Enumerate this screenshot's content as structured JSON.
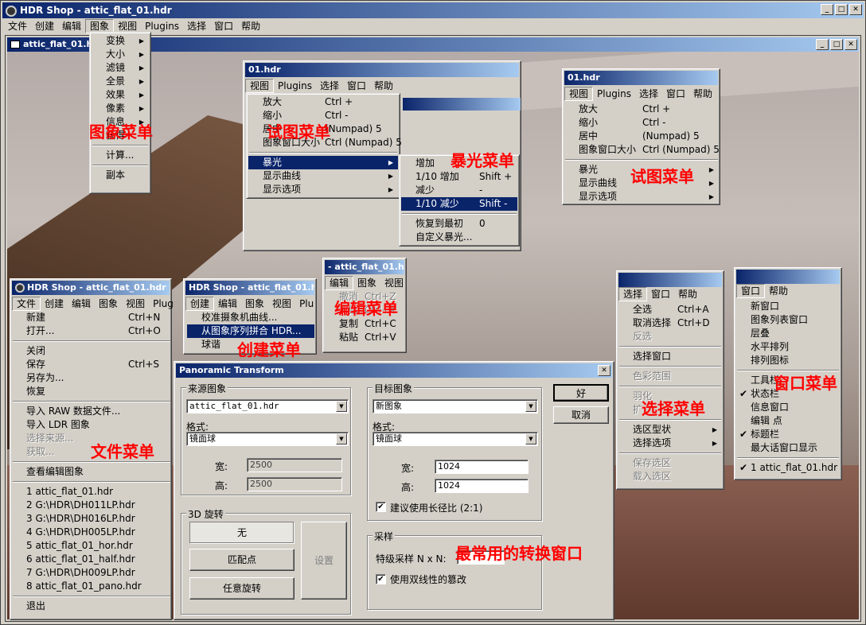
{
  "main": {
    "title": "HDR Shop - attic_flat_01.hdr",
    "menu": [
      "文件",
      "创建",
      "编辑",
      "图象",
      "视图",
      "Plugins",
      "选择",
      "窗口",
      "帮助"
    ]
  },
  "child": {
    "title": "attic_flat_01.hdr"
  },
  "image_menu": {
    "items": [
      "变换",
      "大小",
      "滤镜",
      "全景",
      "效果",
      "像素",
      "信息",
      "获得",
      "计算...",
      "副本"
    ],
    "label": "图象菜单"
  },
  "view1": {
    "title": "01.hdr",
    "menu": [
      "视图",
      "Plugins",
      "选择",
      "窗口",
      "帮助"
    ],
    "items": [
      "放大",
      "缩小",
      "居中",
      "图象窗口大小",
      "暴光",
      "显示曲线",
      "显示选项"
    ],
    "shortcuts": [
      "Ctrl +",
      "Ctrl -",
      "(Numpad) 5",
      "Ctrl (Numpad) 5"
    ],
    "label": "试图菜单"
  },
  "exposure": {
    "items": [
      "增加",
      "1/10 增加",
      "减少",
      "1/10 减少",
      "恢复到最初",
      "自定义暴光..."
    ],
    "shortcuts": [
      "Shift +",
      "-",
      "Shift -",
      "0"
    ],
    "label": "暴光菜单"
  },
  "view2": {
    "title": "01.hdr",
    "menu": [
      "视图",
      "Plugins",
      "选择",
      "窗口",
      "帮助"
    ],
    "items": [
      "放大",
      "缩小",
      "居中",
      "图象窗口大小",
      "暴光",
      "显示曲线",
      "显示选项"
    ],
    "shortcuts": [
      "Ctrl +",
      "Ctrl -",
      "(Numpad) 5",
      "Ctrl (Numpad) 5"
    ],
    "label": "试图菜单"
  },
  "file": {
    "title": "HDR Shop - attic_flat_01.hdr",
    "menu": [
      "文件",
      "创建",
      "编辑",
      "图象",
      "视图",
      "Plug"
    ],
    "items": [
      "新建",
      "打开...",
      "关闭",
      "保存",
      "另存为...",
      "恢复",
      "导入 RAW 数据文件...",
      "导入 LDR 图象",
      "选择来源...",
      "获取...",
      "查看编辑图象",
      "1 attic_flat_01.hdr",
      "2 G:\\HDR\\DH011LP.hdr",
      "3 G:\\HDR\\DH016LP.hdr",
      "4 G:\\HDR\\DH005LP.hdr",
      "5 attic_flat_01_hor.hdr",
      "6 attic_flat_01_half.hdr",
      "7 G:\\HDR\\DH009LP.hdr",
      "8 attic_flat_01_pano.hdr",
      "退出"
    ],
    "shortcuts": [
      "Ctrl+N",
      "Ctrl+O",
      "Ctrl+S"
    ],
    "label": "文件菜单"
  },
  "create": {
    "title": "HDR Shop - attic_flat_01.hdr",
    "menu": [
      "创建",
      "编辑",
      "图象",
      "视图",
      "Plu"
    ],
    "items": [
      "校准摄象机曲线...",
      "从图象序列拼合 HDR...",
      "球谐"
    ],
    "label": "创建菜单"
  },
  "edit": {
    "title": "- attic_flat_01.hdr",
    "menu": [
      "编辑",
      "图象",
      "视图"
    ],
    "items": [
      "撤消",
      "剪贴",
      "复制",
      "粘贴"
    ],
    "shortcuts": [
      "Ctrl+Z",
      "Ctrl+X",
      "Ctrl+C",
      "Ctrl+V"
    ],
    "label": "编辑菜单"
  },
  "select": {
    "menu": [
      "选择",
      "窗口",
      "帮助"
    ],
    "items": [
      "全选",
      "取消选择",
      "反选",
      "选择窗口",
      "色彩范围",
      "羽化",
      "扩",
      "选区型状",
      "选择选项",
      "保存选区",
      "载入选区"
    ],
    "shortcuts": [
      "Ctrl+A",
      "Ctrl+D"
    ],
    "label": "选择菜单"
  },
  "window": {
    "menu": [
      "窗口",
      "帮助"
    ],
    "items": [
      "新窗口",
      "图象列表窗口",
      "层叠",
      "水平排列",
      "排列图标",
      "工具栏",
      "状态栏",
      "信息窗口",
      "编辑 点",
      "标题栏",
      "最大话窗口显示",
      "1 attic_flat_01.hdr"
    ],
    "label": "窗口菜单"
  },
  "dialog": {
    "title": "Panoramic Transform",
    "close": "✕",
    "source_group": "来源图象",
    "source_value": "attic_flat_01.hdr",
    "format_label": "格式:",
    "source_format": "镜面球",
    "width_label": "宽:",
    "height_label": "高:",
    "source_width": "2500",
    "source_height": "2500",
    "target_group": "目标图象",
    "target_value": "新图象",
    "target_format": "镜面球",
    "target_width": "1024",
    "target_height": "1024",
    "aspect_label": "建议使用长径比 (2:1)",
    "rotation_group": "3D 旋转",
    "rot_none": "无",
    "rot_match": "匹配点",
    "rot_any": "任意旋转",
    "settings": "设置",
    "ok": "好",
    "cancel": "取消",
    "sampling_group": "采样",
    "supersample_label": "特级采样 N x N:",
    "bilinear_label": "使用双线性的篡改",
    "label": "最常用的转换窗口"
  },
  "icons": {
    "app": "hdrshop-app-icon",
    "check": "checkmark-icon",
    "arrow": "submenu-arrow-icon"
  }
}
